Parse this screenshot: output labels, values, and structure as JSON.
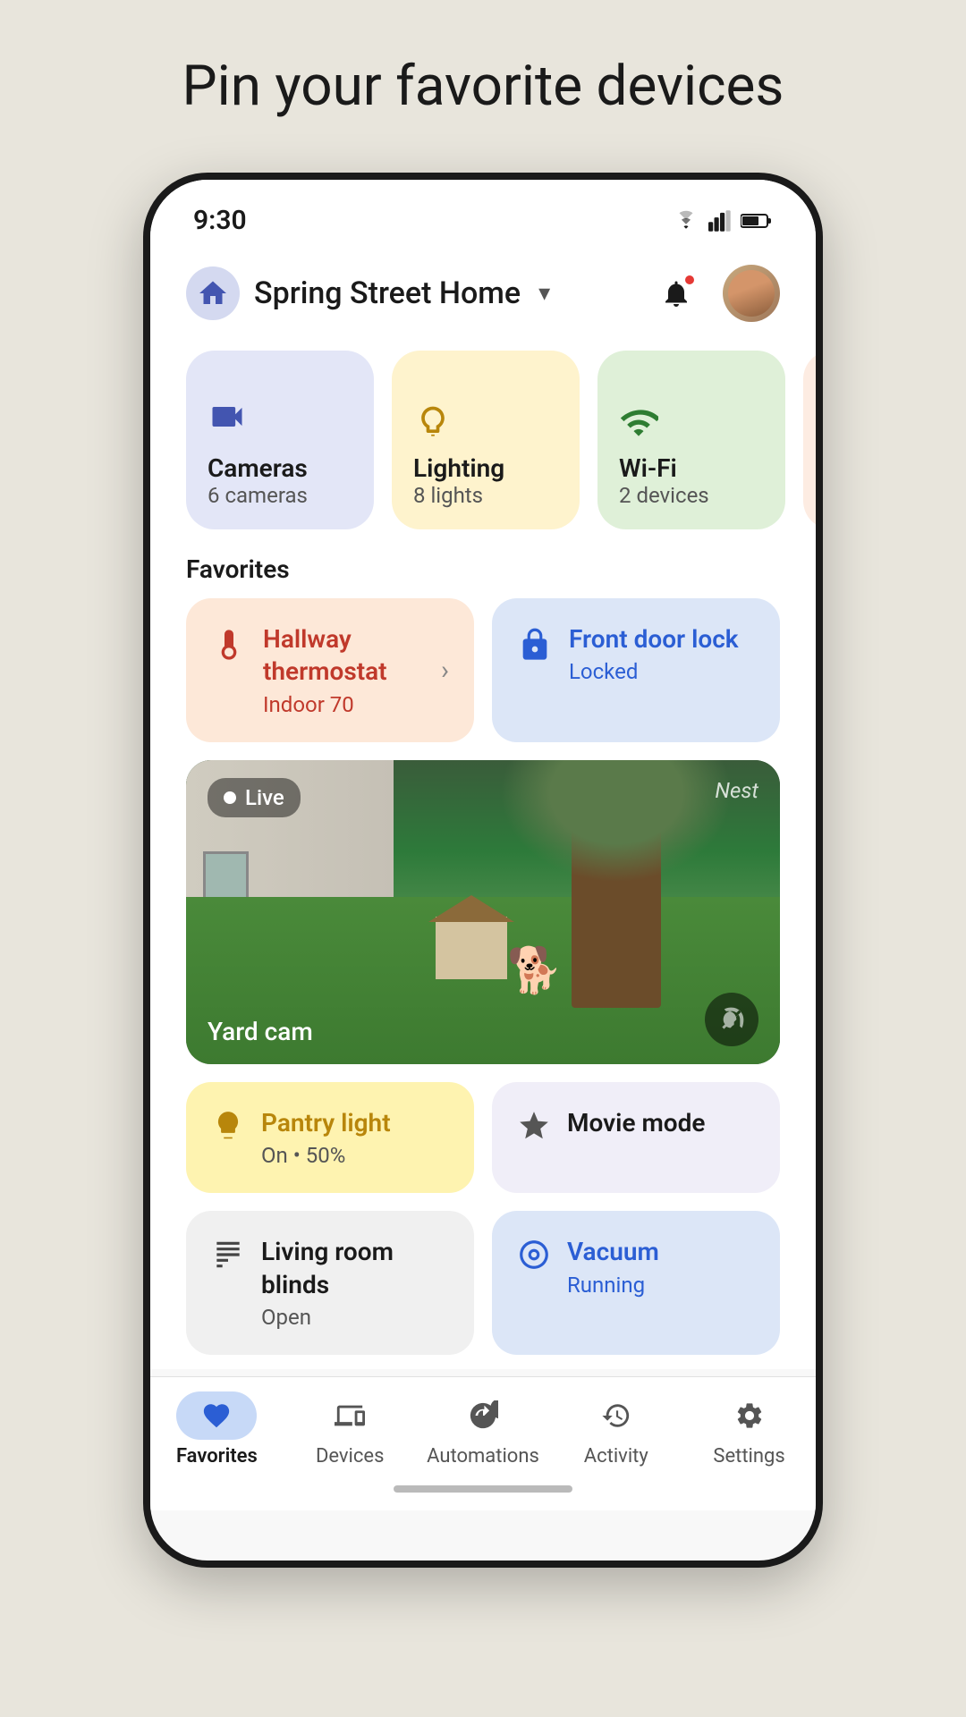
{
  "page": {
    "title": "Pin your favorite devices"
  },
  "status_bar": {
    "time": "9:30"
  },
  "header": {
    "home_name": "Spring Street Home",
    "chevron": "▾"
  },
  "categories": [
    {
      "id": "cameras",
      "name": "Cameras",
      "sub": "6 cameras",
      "icon": "📷",
      "color": "cat-cameras"
    },
    {
      "id": "lighting",
      "name": "Lighting",
      "sub": "8 lights",
      "icon": "🔆",
      "color": "cat-lighting"
    },
    {
      "id": "wifi",
      "name": "Wi-Fi",
      "sub": "2 devices",
      "icon": "📶",
      "color": "cat-wifi"
    }
  ],
  "favorites_section": {
    "label": "Favorites"
  },
  "favorite_cards": [
    {
      "id": "thermostat",
      "name": "Hallway thermostat",
      "status": "Indoor 70",
      "icon": "🌡️",
      "type": "thermostat"
    },
    {
      "id": "lock",
      "name": "Front door lock",
      "status": "Locked",
      "icon": "🔒",
      "type": "lock"
    }
  ],
  "camera": {
    "badge": "Live",
    "brand": "Nest",
    "label": "Yard cam"
  },
  "bottom_cards": [
    {
      "id": "pantry",
      "name": "Pantry light",
      "status": "On • 50%",
      "icon": "💡",
      "type": "pantry"
    },
    {
      "id": "movie",
      "name": "Movie mode",
      "status": "",
      "icon": "✨",
      "type": "movie"
    },
    {
      "id": "blinds",
      "name": "Living room blinds",
      "status": "Open",
      "icon": "⊞",
      "type": "blinds"
    },
    {
      "id": "vacuum",
      "name": "Vacuum",
      "status": "Running",
      "icon": "🤖",
      "type": "vacuum"
    }
  ],
  "nav": {
    "items": [
      {
        "id": "favorites",
        "label": "Favorites",
        "icon": "♥",
        "active": true
      },
      {
        "id": "devices",
        "label": "Devices",
        "icon": "⊡",
        "active": false
      },
      {
        "id": "automations",
        "label": "Automations",
        "icon": "✦",
        "active": false
      },
      {
        "id": "activity",
        "label": "Activity",
        "icon": "↺",
        "active": false
      },
      {
        "id": "settings",
        "label": "Settings",
        "icon": "⚙",
        "active": false
      }
    ]
  }
}
